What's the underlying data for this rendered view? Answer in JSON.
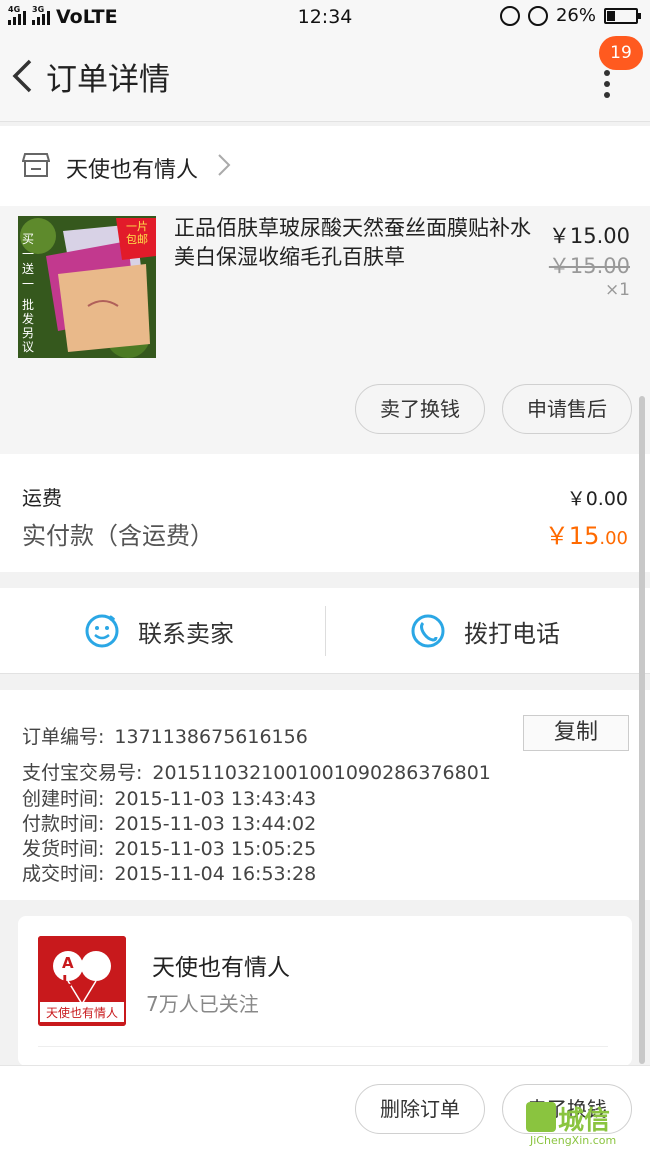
{
  "status_bar": {
    "network_left": "4G",
    "network_right": "3G",
    "volte": "VoLTE",
    "time": "12:34",
    "battery": "26%"
  },
  "header": {
    "title": "订单详情",
    "badge_count": "19"
  },
  "shop": {
    "name": "天使也有情人"
  },
  "item": {
    "title": "正品佰肤草玻尿酸天然蚕丝面膜贴补水美白保湿收缩毛孔百肤草",
    "price": "￥15.00",
    "original_price": "￥15.00",
    "quantity": "×1",
    "thumb_text_left": "买一送一",
    "thumb_text_bottom": "批发另议",
    "thumb_text_corner": "一片包邮",
    "buttons": {
      "sell": "卖了换钱",
      "after_sale": "申请售后"
    }
  },
  "fees": {
    "shipping_label": "运费",
    "shipping_value": "￥0.00",
    "paid_label": "实付款（含运费）",
    "paid_value_main": "￥15",
    "paid_value_cents": ".00"
  },
  "contact": {
    "seller": "联系卖家",
    "phone": "拨打电话"
  },
  "order_info": {
    "copy_button": "复制",
    "rows": [
      {
        "label": "订单编号:",
        "value": "1371138675616156"
      },
      {
        "label": "支付宝交易号:",
        "value": "2015110321001001090286376801"
      },
      {
        "label": "创建时间:",
        "value": "2015-11-03 13:43:43"
      },
      {
        "label": "付款时间:",
        "value": "2015-11-03 13:44:02"
      },
      {
        "label": "发货时间:",
        "value": "2015-11-03 15:05:25"
      },
      {
        "label": "成交时间:",
        "value": "2015-11-04 16:53:28"
      }
    ]
  },
  "shop_card": {
    "name": "天使也有情人",
    "followers": "7万人已关注",
    "logo_letters": "A L",
    "logo_text": "天使也有情人"
  },
  "bottom_bar": {
    "delete": "删除订单",
    "sell": "卖了换钱"
  },
  "watermark": {
    "text": "城信",
    "url": "JiChengXin.com"
  },
  "colors": {
    "accent_orange": "#ff6a00",
    "badge": "#ff5a1f",
    "icon_blue": "#2ba7e5"
  }
}
